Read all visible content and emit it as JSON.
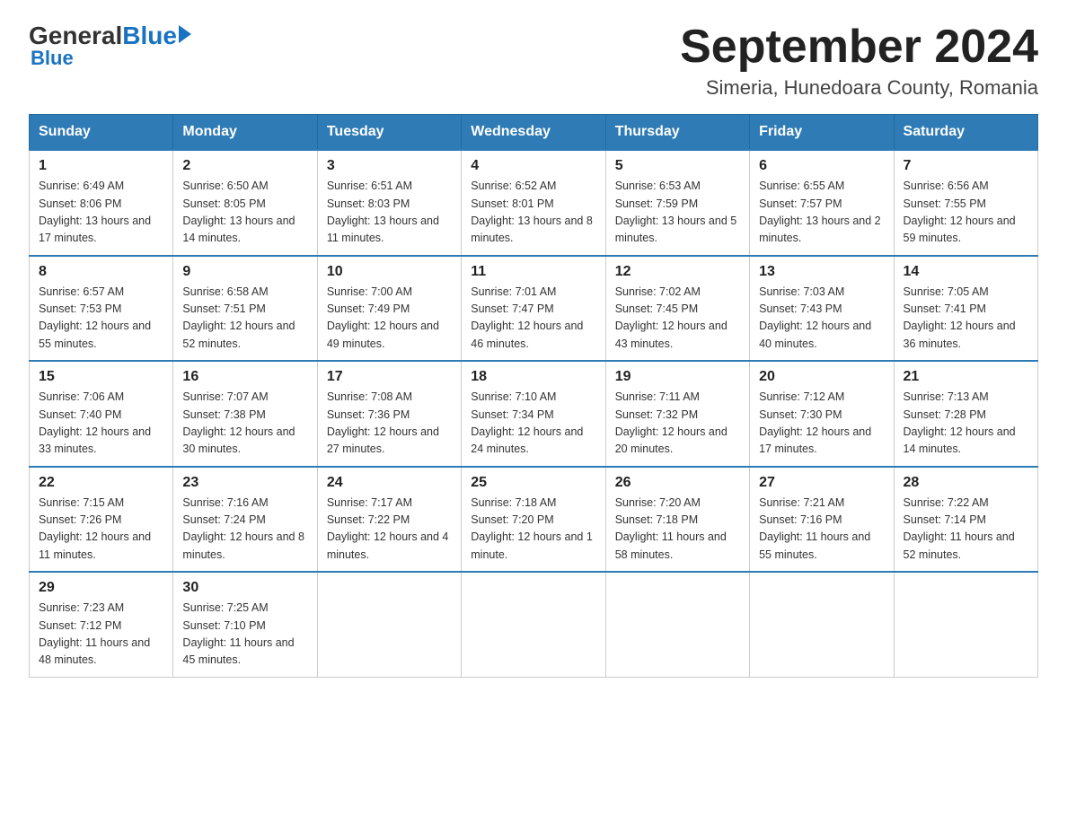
{
  "header": {
    "logo_general": "General",
    "logo_blue": "Blue",
    "title": "September 2024",
    "subtitle": "Simeria, Hunedoara County, Romania"
  },
  "columns": [
    "Sunday",
    "Monday",
    "Tuesday",
    "Wednesday",
    "Thursday",
    "Friday",
    "Saturday"
  ],
  "weeks": [
    [
      {
        "day": "1",
        "sunrise": "6:49 AM",
        "sunset": "8:06 PM",
        "daylight": "13 hours and 17 minutes."
      },
      {
        "day": "2",
        "sunrise": "6:50 AM",
        "sunset": "8:05 PM",
        "daylight": "13 hours and 14 minutes."
      },
      {
        "day": "3",
        "sunrise": "6:51 AM",
        "sunset": "8:03 PM",
        "daylight": "13 hours and 11 minutes."
      },
      {
        "day": "4",
        "sunrise": "6:52 AM",
        "sunset": "8:01 PM",
        "daylight": "13 hours and 8 minutes."
      },
      {
        "day": "5",
        "sunrise": "6:53 AM",
        "sunset": "7:59 PM",
        "daylight": "13 hours and 5 minutes."
      },
      {
        "day": "6",
        "sunrise": "6:55 AM",
        "sunset": "7:57 PM",
        "daylight": "13 hours and 2 minutes."
      },
      {
        "day": "7",
        "sunrise": "6:56 AM",
        "sunset": "7:55 PM",
        "daylight": "12 hours and 59 minutes."
      }
    ],
    [
      {
        "day": "8",
        "sunrise": "6:57 AM",
        "sunset": "7:53 PM",
        "daylight": "12 hours and 55 minutes."
      },
      {
        "day": "9",
        "sunrise": "6:58 AM",
        "sunset": "7:51 PM",
        "daylight": "12 hours and 52 minutes."
      },
      {
        "day": "10",
        "sunrise": "7:00 AM",
        "sunset": "7:49 PM",
        "daylight": "12 hours and 49 minutes."
      },
      {
        "day": "11",
        "sunrise": "7:01 AM",
        "sunset": "7:47 PM",
        "daylight": "12 hours and 46 minutes."
      },
      {
        "day": "12",
        "sunrise": "7:02 AM",
        "sunset": "7:45 PM",
        "daylight": "12 hours and 43 minutes."
      },
      {
        "day": "13",
        "sunrise": "7:03 AM",
        "sunset": "7:43 PM",
        "daylight": "12 hours and 40 minutes."
      },
      {
        "day": "14",
        "sunrise": "7:05 AM",
        "sunset": "7:41 PM",
        "daylight": "12 hours and 36 minutes."
      }
    ],
    [
      {
        "day": "15",
        "sunrise": "7:06 AM",
        "sunset": "7:40 PM",
        "daylight": "12 hours and 33 minutes."
      },
      {
        "day": "16",
        "sunrise": "7:07 AM",
        "sunset": "7:38 PM",
        "daylight": "12 hours and 30 minutes."
      },
      {
        "day": "17",
        "sunrise": "7:08 AM",
        "sunset": "7:36 PM",
        "daylight": "12 hours and 27 minutes."
      },
      {
        "day": "18",
        "sunrise": "7:10 AM",
        "sunset": "7:34 PM",
        "daylight": "12 hours and 24 minutes."
      },
      {
        "day": "19",
        "sunrise": "7:11 AM",
        "sunset": "7:32 PM",
        "daylight": "12 hours and 20 minutes."
      },
      {
        "day": "20",
        "sunrise": "7:12 AM",
        "sunset": "7:30 PM",
        "daylight": "12 hours and 17 minutes."
      },
      {
        "day": "21",
        "sunrise": "7:13 AM",
        "sunset": "7:28 PM",
        "daylight": "12 hours and 14 minutes."
      }
    ],
    [
      {
        "day": "22",
        "sunrise": "7:15 AM",
        "sunset": "7:26 PM",
        "daylight": "12 hours and 11 minutes."
      },
      {
        "day": "23",
        "sunrise": "7:16 AM",
        "sunset": "7:24 PM",
        "daylight": "12 hours and 8 minutes."
      },
      {
        "day": "24",
        "sunrise": "7:17 AM",
        "sunset": "7:22 PM",
        "daylight": "12 hours and 4 minutes."
      },
      {
        "day": "25",
        "sunrise": "7:18 AM",
        "sunset": "7:20 PM",
        "daylight": "12 hours and 1 minute."
      },
      {
        "day": "26",
        "sunrise": "7:20 AM",
        "sunset": "7:18 PM",
        "daylight": "11 hours and 58 minutes."
      },
      {
        "day": "27",
        "sunrise": "7:21 AM",
        "sunset": "7:16 PM",
        "daylight": "11 hours and 55 minutes."
      },
      {
        "day": "28",
        "sunrise": "7:22 AM",
        "sunset": "7:14 PM",
        "daylight": "11 hours and 52 minutes."
      }
    ],
    [
      {
        "day": "29",
        "sunrise": "7:23 AM",
        "sunset": "7:12 PM",
        "daylight": "11 hours and 48 minutes."
      },
      {
        "day": "30",
        "sunrise": "7:25 AM",
        "sunset": "7:10 PM",
        "daylight": "11 hours and 45 minutes."
      },
      null,
      null,
      null,
      null,
      null
    ]
  ]
}
